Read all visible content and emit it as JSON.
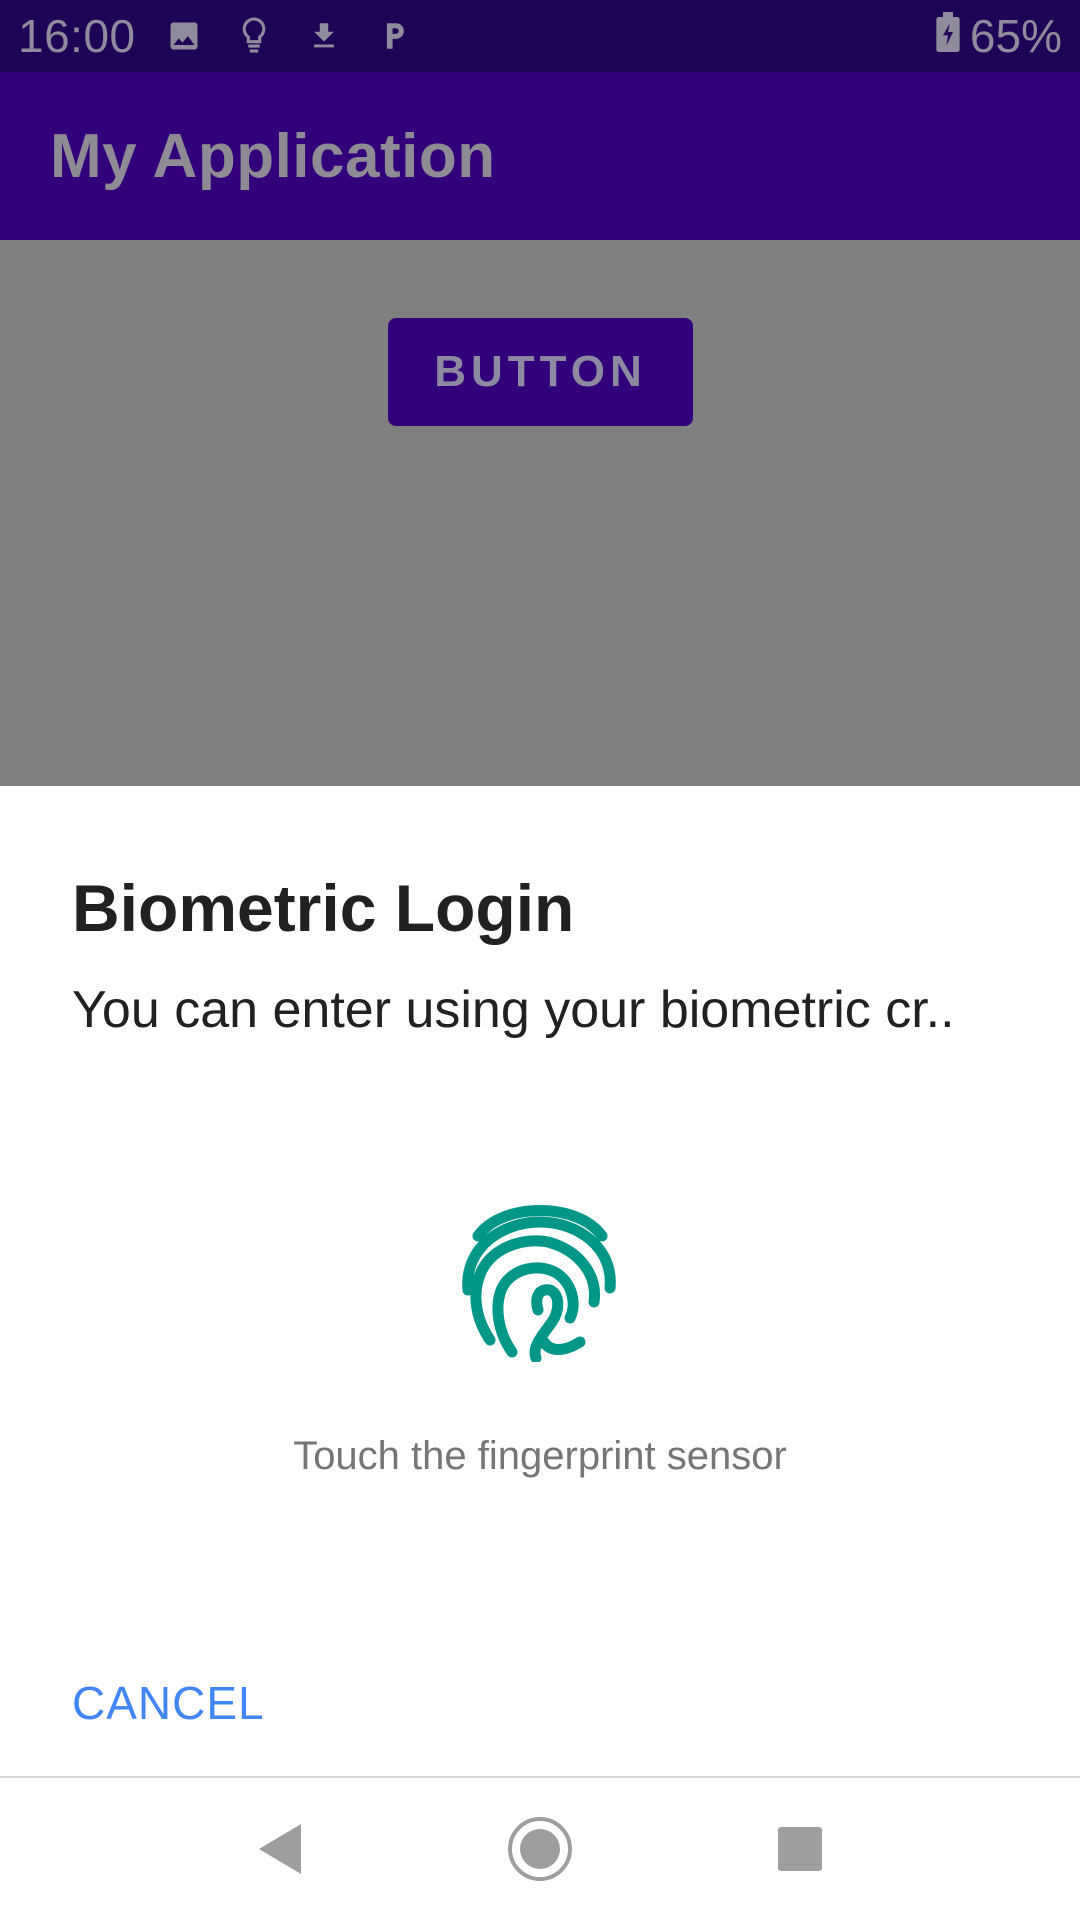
{
  "status_bar": {
    "time": "16:00",
    "battery": "65%",
    "icons": [
      "image-icon",
      "lightbulb-icon",
      "download-icon",
      "parking-icon",
      "battery-icon"
    ]
  },
  "app_bar": {
    "title": "My Application"
  },
  "content": {
    "button_label": "BUTTON"
  },
  "dialog": {
    "title": "Biometric Login",
    "description": "You can enter using your biometric cr..",
    "status": "Touch the fingerprint sensor",
    "cancel_label": "CANCEL"
  },
  "colors": {
    "status_bar": "#1e0454",
    "primary": "#31007a",
    "scrim": "#808080",
    "fingerprint": "#009688",
    "cancel_text": "#4285f4"
  },
  "nav_bar": {
    "buttons": [
      "back-icon",
      "home-icon",
      "recents-icon"
    ]
  }
}
